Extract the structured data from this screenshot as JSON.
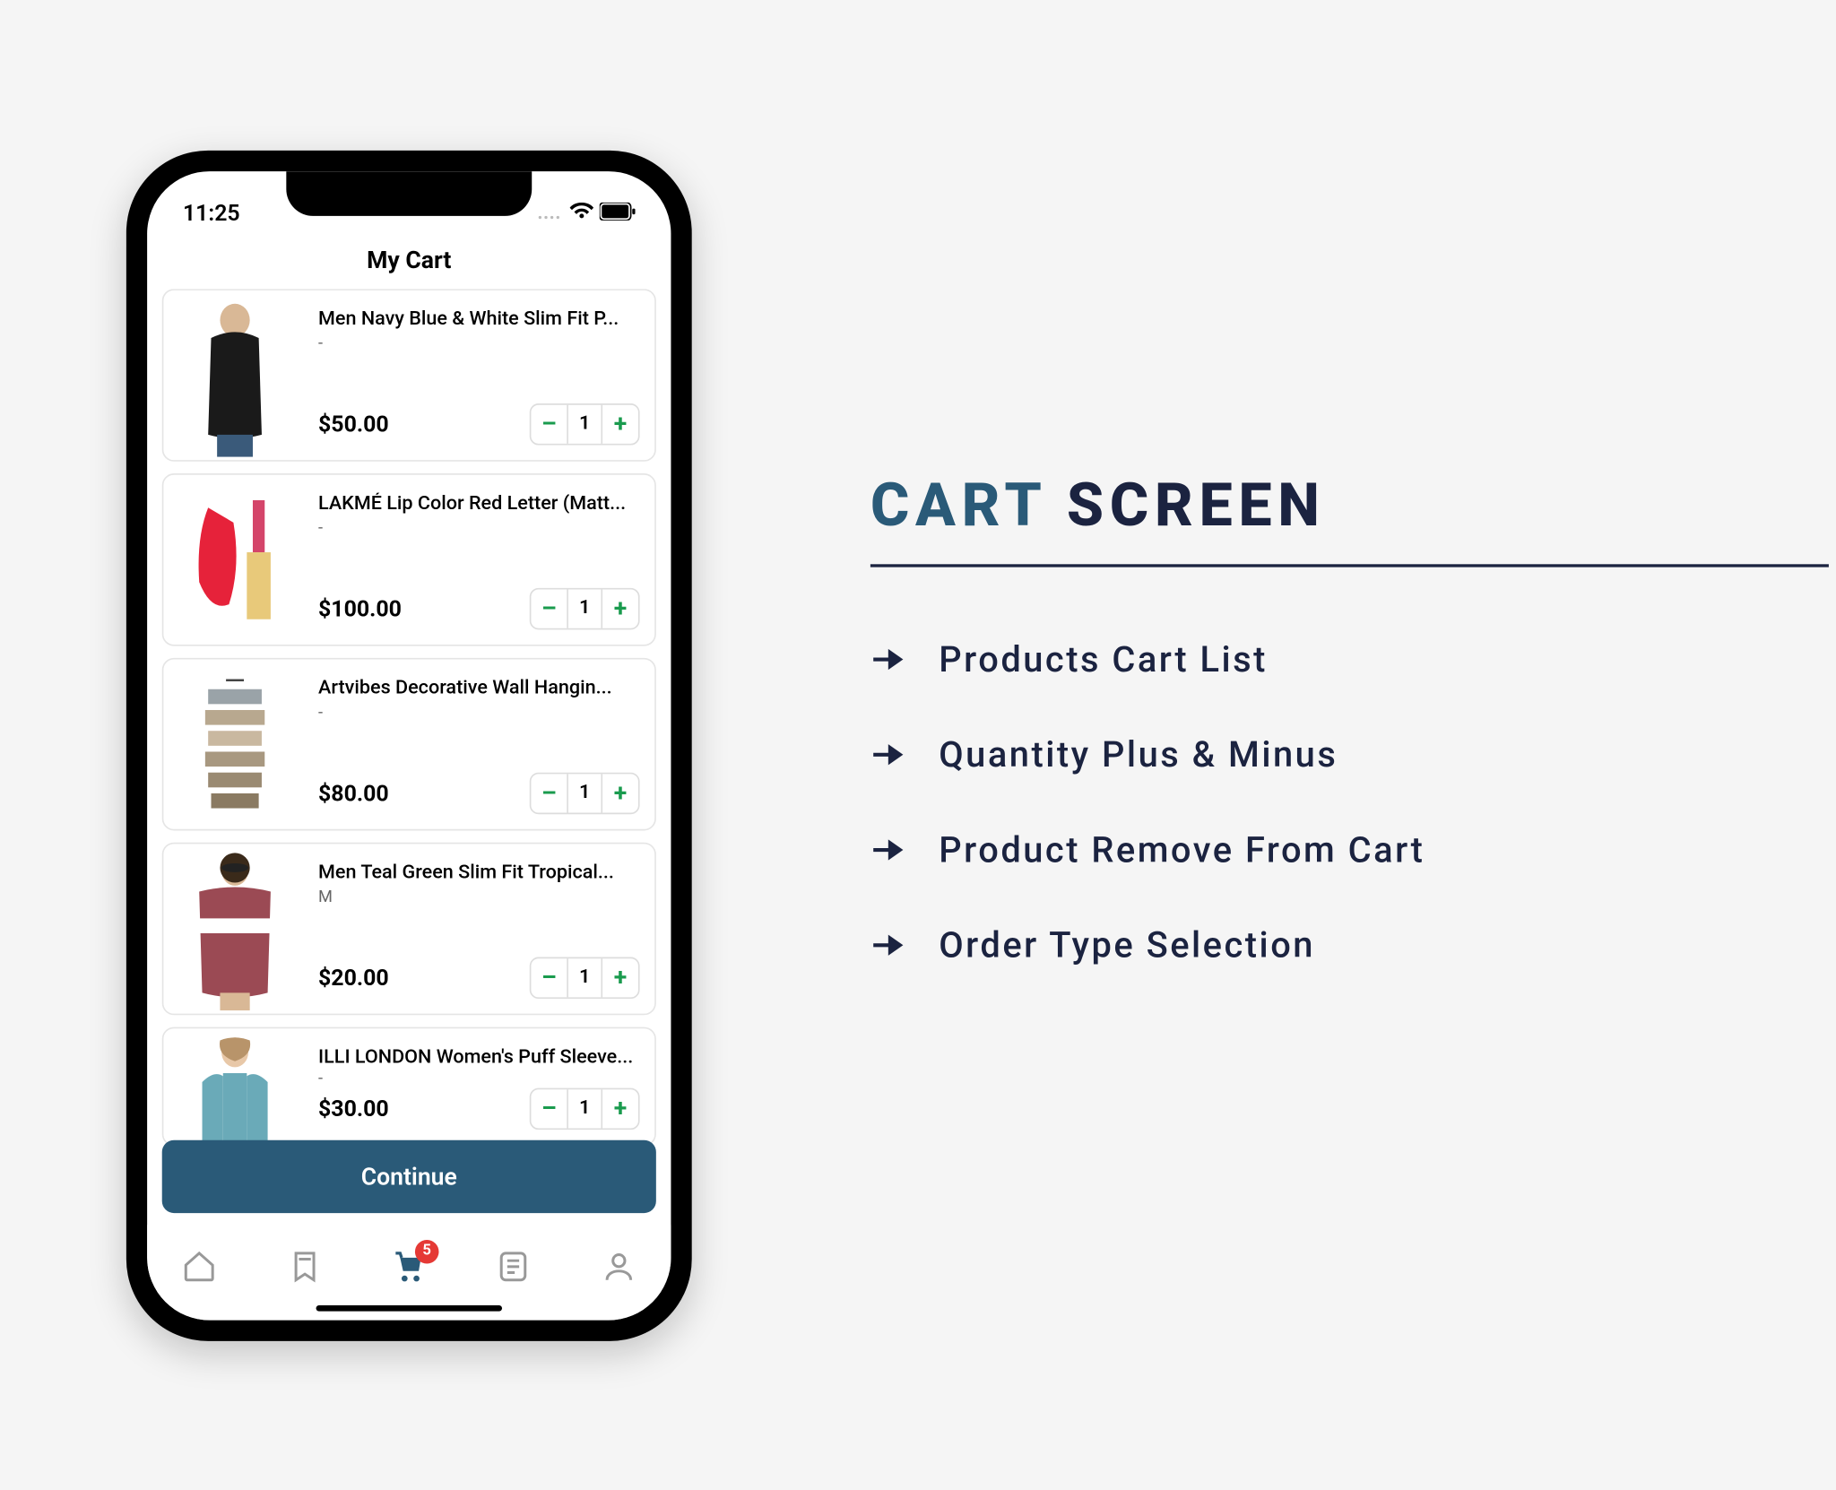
{
  "status": {
    "time": "11:25"
  },
  "page_title": "My Cart",
  "cart": [
    {
      "name": "Men Navy Blue & White Slim Fit P...",
      "variant": "-",
      "price": "$50.00",
      "qty": "1"
    },
    {
      "name": "LAKMÉ Lip Color Red Letter (Matt...",
      "variant": "-",
      "price": "$100.00",
      "qty": "1"
    },
    {
      "name": "Artvibes Decorative Wall Hangin...",
      "variant": "-",
      "price": "$80.00",
      "qty": "1"
    },
    {
      "name": "Men Teal Green Slim Fit Tropical...",
      "variant": "M",
      "price": "$20.00",
      "qty": "1"
    },
    {
      "name": "ILLI LONDON Women's Puff Sleeve...",
      "variant": "-",
      "price": "$30.00",
      "qty": "1"
    }
  ],
  "qty_minus": "–",
  "qty_plus": "+",
  "continue_label": "Continue",
  "cart_badge": "5",
  "heading": {
    "accent": "CART",
    "dark": " SCREEN"
  },
  "features": [
    "Products Cart List",
    "Quantity Plus & Minus",
    "Product Remove From Cart",
    "Order Type Selection"
  ]
}
